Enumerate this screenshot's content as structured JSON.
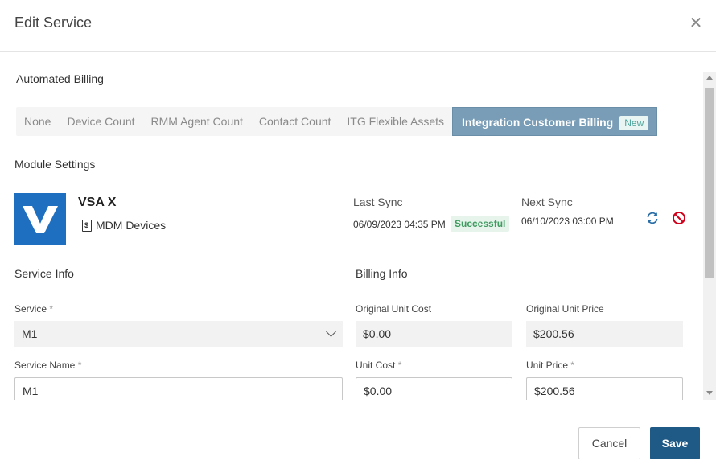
{
  "dialog": {
    "title": "Edit Service"
  },
  "automated_billing": {
    "label": "Automated Billing",
    "tabs": [
      {
        "label": "None"
      },
      {
        "label": "Device Count"
      },
      {
        "label": "RMM Agent Count"
      },
      {
        "label": "Contact Count"
      },
      {
        "label": "ITG Flexible Assets"
      },
      {
        "label": "Integration Customer Billing",
        "badge": "New",
        "active": true
      }
    ]
  },
  "module_settings": {
    "label": "Module Settings",
    "integration_name": "VSA X",
    "module_type": "MDM Devices",
    "last_sync_label": "Last Sync",
    "last_sync_value": "06/09/2023 04:35 PM",
    "last_sync_status": "Successful",
    "next_sync_label": "Next Sync",
    "next_sync_value": "06/10/2023 03:00 PM"
  },
  "service_info": {
    "label": "Service Info",
    "service_label": "Service",
    "service_value": "M1",
    "service_name_label": "Service Name",
    "service_name_value": "M1",
    "required_mark": "*"
  },
  "billing_info": {
    "label": "Billing Info",
    "original_unit_cost_label": "Original Unit Cost",
    "original_unit_cost_value": "$0.00",
    "original_unit_price_label": "Original Unit Price",
    "original_unit_price_value": "$200.56",
    "unit_cost_label": "Unit Cost",
    "unit_cost_value": "$0.00",
    "unit_price_label": "Unit Price",
    "unit_price_value": "$200.56"
  },
  "footer": {
    "cancel_label": "Cancel",
    "save_label": "Save"
  },
  "colors": {
    "active_tab": "#7a9db7",
    "save_button": "#1f5985",
    "logo": "#1e6fc0",
    "success": "#3f9b5f",
    "disable_icon": "#d0021b",
    "sync_icon": "#2b6fa8"
  },
  "icons": {
    "close": "close-icon",
    "sync": "sync-icon",
    "disable": "disable-icon",
    "document": "document-dollar-icon",
    "chevron": "chevron-down-icon"
  }
}
